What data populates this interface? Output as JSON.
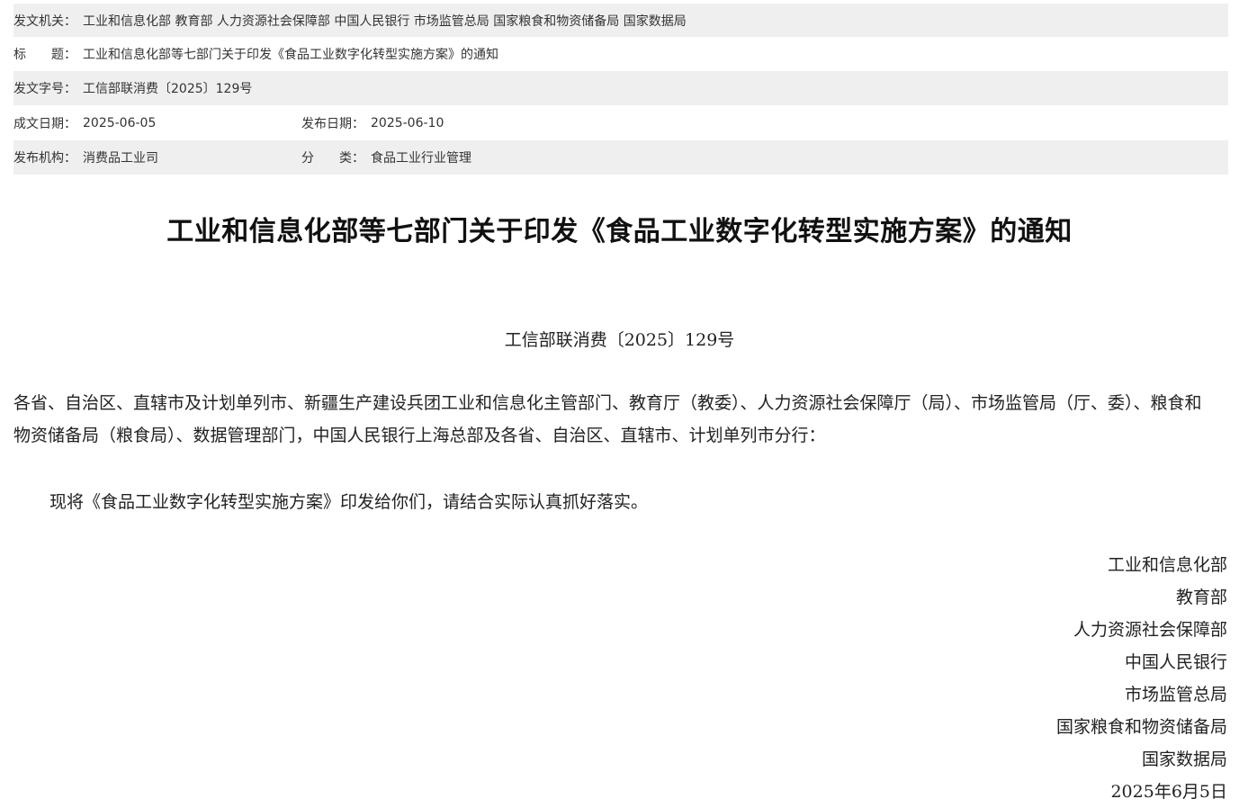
{
  "meta": {
    "issuer_label": "发文机关：",
    "issuer_value": "工业和信息化部 教育部 人力资源社会保障部 中国人民银行 市场监管总局 国家粮食和物资储备局 国家数据局",
    "title_label": "标　　题：",
    "title_value": "工业和信息化部等七部门关于印发《食品工业数字化转型实施方案》的通知",
    "docno_label": "发文字号：",
    "docno_value": "工信部联消费〔2025〕129号",
    "created_label": "成文日期：",
    "created_value": "2025-06-05",
    "published_label": "发布日期：",
    "published_value": "2025-06-10",
    "org_label": "发布机构：",
    "org_value": "消费品工业司",
    "category_label": "分　　类：",
    "category_value": "食品工业行业管理"
  },
  "document": {
    "title": "工业和信息化部等七部门关于印发《食品工业数字化转型实施方案》的通知",
    "doc_number": "工信部联消费〔2025〕129号",
    "addressee": "各省、自治区、直辖市及计划单列市、新疆生产建设兵团工业和信息化主管部门、教育厅（教委）、人力资源社会保障厅（局）、市场监管局（厅、委）、粮食和物资储备局（粮食局）、数据管理部门，中国人民银行上海总部及各省、自治区、直辖市、计划单列市分行：",
    "paragraph": "现将《食品工业数字化转型实施方案》印发给你们，请结合实际认真抓好落实。",
    "signers": [
      "工业和信息化部",
      "教育部",
      "人力资源社会保障部",
      "中国人民银行",
      "市场监管总局",
      "国家粮食和物资储备局",
      "国家数据局"
    ],
    "date": "2025年6月5日"
  }
}
